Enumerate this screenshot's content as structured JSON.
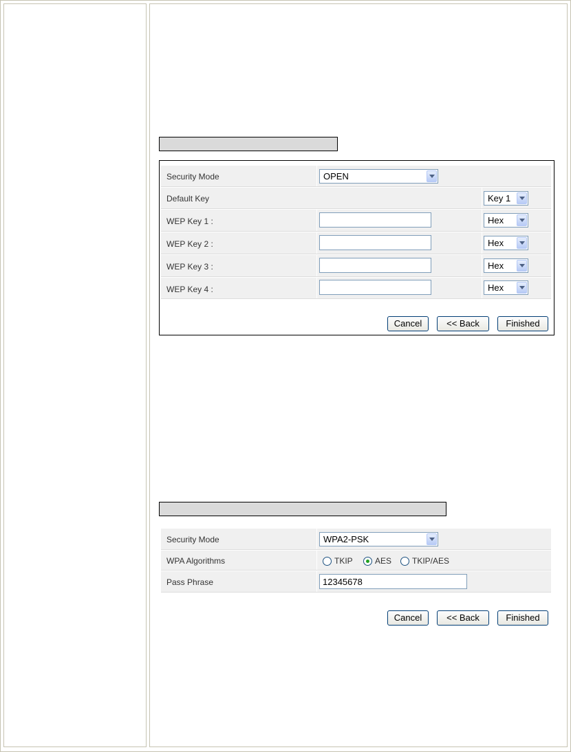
{
  "wep_panel": {
    "security_mode_label": "Security Mode",
    "security_mode_value": "OPEN",
    "default_key_label": "Default Key",
    "default_key_value": "Key 1",
    "wep_keys": [
      {
        "label": "WEP Key 1 :",
        "value": "",
        "format": "Hex"
      },
      {
        "label": "WEP Key 2 :",
        "value": "",
        "format": "Hex"
      },
      {
        "label": "WEP Key 3 :",
        "value": "",
        "format": "Hex"
      },
      {
        "label": "WEP Key 4 :",
        "value": "",
        "format": "Hex"
      }
    ],
    "buttons": {
      "cancel": "Cancel",
      "back": "<< Back",
      "finished": "Finished"
    }
  },
  "wpa_panel": {
    "security_mode_label": "Security Mode",
    "security_mode_value": "WPA2-PSK",
    "algorithms_label": "WPA Algorithms",
    "algorithms": [
      {
        "label": "TKIP",
        "selected": false
      },
      {
        "label": "AES",
        "selected": true
      },
      {
        "label": "TKIP/AES",
        "selected": false
      }
    ],
    "pass_phrase_label": "Pass Phrase",
    "pass_phrase_value": "12345678",
    "buttons": {
      "cancel": "Cancel",
      "back": "<< Back",
      "finished": "Finished"
    }
  }
}
